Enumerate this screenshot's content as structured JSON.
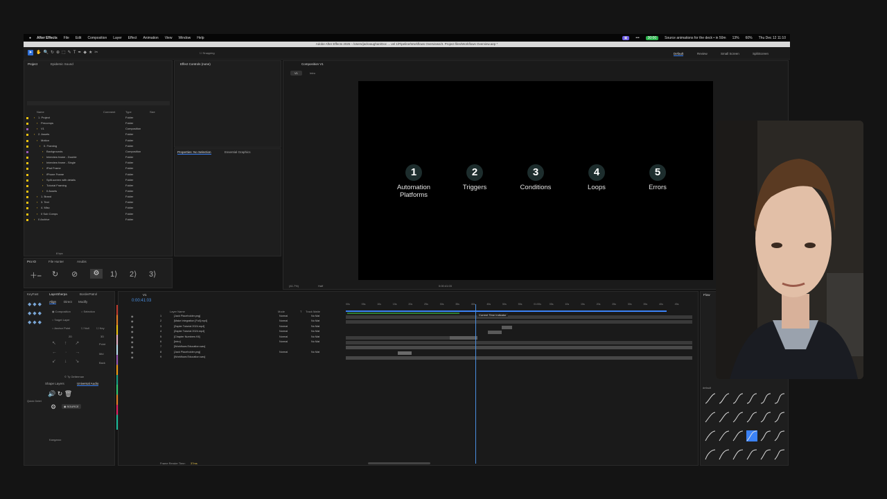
{
  "menubar": {
    "app": "After Effects",
    "items": [
      "File",
      "Edit",
      "Composition",
      "Layer",
      "Effect",
      "Animation",
      "View",
      "Window",
      "Help"
    ],
    "status_timer": "30:00",
    "status_msg": "Source animations for the deck • in 50m",
    "battery1": "13%",
    "battery2": "60%",
    "clock": "Thu Dec 12  11:10"
  },
  "titlebar": "Adobe After Effects 2025 - /Users/jackvaughan/Doc ... vel 1/Pipeline/Workflows Overviews/3. Project files/Workflows Overview.aep *",
  "toolbar": {
    "snapping": "Snapping",
    "workspaces": [
      "Default",
      "Review",
      "Small Screen",
      "SplitScreen"
    ]
  },
  "project": {
    "tabs": [
      "Project",
      "Epidemic Sound"
    ],
    "columns": [
      "Name",
      "Comment",
      "Type",
      "Size"
    ],
    "rows": [
      {
        "name": "1. Project",
        "type": "Folder"
      },
      {
        "name": "Precomps",
        "type": "Folder"
      },
      {
        "name": "V1",
        "type": "Composition"
      },
      {
        "name": "2. Assets",
        "type": "Folder"
      },
      {
        "name": "Motion",
        "type": "Folder"
      },
      {
        "name": "0. Framing",
        "type": "Folder"
      },
      {
        "name": "Backgrounds",
        "type": "Composition"
      },
      {
        "name": "Interview frame - Double",
        "type": "Folder"
      },
      {
        "name": "Interview frame - Single",
        "type": "Folder"
      },
      {
        "name": "iPad Frame",
        "type": "Folder"
      },
      {
        "name": "iPhone Frame",
        "type": "Folder"
      },
      {
        "name": "Split-screen with details",
        "type": "Folder"
      },
      {
        "name": "Tutorial Framing",
        "type": "Folder"
      },
      {
        "name": "0 Assets",
        "type": "Folder"
      },
      {
        "name": "1. Brand",
        "type": "Folder"
      },
      {
        "name": "3. Text",
        "type": "Folder"
      },
      {
        "name": "4. Misc",
        "type": "Folder"
      },
      {
        "name": "0 Sub Comps",
        "type": "Folder"
      },
      {
        "name": "0 Archive",
        "type": "Folder"
      }
    ],
    "bpc": "8 bpc"
  },
  "effect_controls": {
    "title": "Effect Controls (none)"
  },
  "properties": {
    "tabs": [
      "Properties: No Selection",
      "Essential Graphics"
    ]
  },
  "proio": {
    "tabs": [
      "Pro IO",
      "File Hunter",
      "Anubis"
    ],
    "buttons": [
      "1",
      "2",
      "3"
    ]
  },
  "comp_viewer": {
    "title": "Composition V1",
    "crumbs": [
      "V1",
      "Intro"
    ],
    "zoom": "(41.7%)",
    "quality": "Half",
    "time": "0:00:41:03",
    "steps": [
      {
        "num": "1",
        "label": "Automation Platforms"
      },
      {
        "num": "2",
        "label": "Triggers"
      },
      {
        "num": "3",
        "label": "Conditions"
      },
      {
        "num": "4",
        "label": "Loops"
      },
      {
        "num": "5",
        "label": "Errors"
      }
    ]
  },
  "left_tools": {
    "tabs": [
      "KeyFast",
      "LayerSherpa",
      "BorderPatrol"
    ],
    "align_tabs": [
      "Align",
      "Direct",
      "Modify"
    ],
    "options": [
      "Composition",
      "Selection",
      "Target Layer",
      "Anchor Point",
      "Null",
      "Key"
    ],
    "labels": [
      "2D",
      "3D",
      "Point",
      "Mid",
      "Back"
    ],
    "credit": "© Ty Getterman",
    "shape_tabs": [
      "Shape Layers",
      "Universal Audio"
    ],
    "source": "SOURCE",
    "quick": "Quick Delet",
    "kangaroo": "Kangaroo"
  },
  "timeline": {
    "tab": "V1",
    "timecode": "0:00:41:03",
    "columns": [
      "Layer Name",
      "Mode",
      "T",
      "Track Matte"
    ],
    "layers": [
      {
        "num": "1",
        "name": "[Jack Placeholder.png]",
        "mode": "Normal",
        "matte": "No Mat"
      },
      {
        "num": "2",
        "name": "[Make Integration [Full].mp4]",
        "mode": "Normal",
        "matte": "No Mat"
      },
      {
        "num": "3",
        "name": "[Zapier Tutorial 2024.mp4]",
        "mode": "Normal",
        "matte": "No Mat"
      },
      {
        "num": "4",
        "name": "[Zapier Tutorial 2024.mp4]",
        "mode": "Normal",
        "matte": "No Mat"
      },
      {
        "num": "5",
        "name": "[Chapter Numbers Kit]",
        "mode": "Normal",
        "matte": "No Mat"
      },
      {
        "num": "6",
        "name": "[Intro]",
        "mode": "Normal",
        "matte": "No Mat"
      },
      {
        "num": "7",
        "name": "[Workflows Education.wav]",
        "mode": "",
        "matte": ""
      },
      {
        "num": "8",
        "name": "[Jack Placeholder.png]",
        "mode": "Normal",
        "matte": "No Mat"
      },
      {
        "num": "9",
        "name": "[Workflows Education.wav]",
        "mode": "",
        "matte": ""
      }
    ],
    "ruler": [
      "00s",
      "05s",
      "10s",
      "15s",
      "20s",
      "25s",
      "30s",
      "35s",
      "40s",
      "45s",
      "50s",
      "55s",
      "01:00s",
      "05s",
      "10s",
      "15s",
      "20s",
      "25s",
      "30s",
      "35s",
      "40s",
      "45s"
    ],
    "tooltip": "Current Time Indicator",
    "render_label": "Frame Render Time:",
    "render_value": "37ms"
  },
  "flow": {
    "tab": "Flow",
    "preset": "default",
    "selected": "quart"
  },
  "colors": {
    "accent": "#3b82f6",
    "canvas": "#000000",
    "step_circle": "#1d2d2d",
    "timer_green": "#2bb24c",
    "playhead": "#4a90e2"
  }
}
